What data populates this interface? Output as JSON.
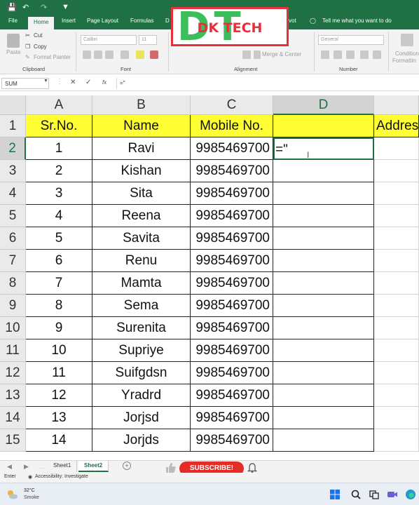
{
  "ribbon_tabs": [
    "File",
    "Home",
    "Insert",
    "Page Layout",
    "Formulas",
    "D",
    "vot"
  ],
  "tell_me": "Tell me what you want to do",
  "clipboard": {
    "cut": "Cut",
    "copy": "Copy",
    "paste": "Paste",
    "format_painter": "Format Painter",
    "group": "Clipboard"
  },
  "font": {
    "name": "Calibri",
    "size": "11",
    "group": "Font"
  },
  "alignment": {
    "merge": "Merge & Center",
    "group": "Alignment"
  },
  "number": {
    "format": "General",
    "group": "Number"
  },
  "styles": {
    "conditional": "Condition",
    "formatting": "Formattin"
  },
  "logo": {
    "letters": "DT",
    "brand": "DK TECH"
  },
  "formula_bar": {
    "name_box": "SUM",
    "fx": "fx",
    "content": "=\""
  },
  "grid": {
    "columns": [
      "A",
      "B",
      "C",
      "D",
      ""
    ],
    "header_row": {
      "sr": "Sr.No.",
      "name": "Name",
      "mobile": "Mobile No.",
      "d": "",
      "address": "Addres"
    },
    "rows": [
      {
        "row": "2",
        "sr": "1",
        "name": "Ravi",
        "mobile": "9985469700",
        "d": "=\""
      },
      {
        "row": "3",
        "sr": "2",
        "name": "Kishan",
        "mobile": "9985469700",
        "d": ""
      },
      {
        "row": "4",
        "sr": "3",
        "name": "Sita",
        "mobile": "9985469700",
        "d": ""
      },
      {
        "row": "5",
        "sr": "4",
        "name": "Reena",
        "mobile": "9985469700",
        "d": ""
      },
      {
        "row": "6",
        "sr": "5",
        "name": "Savita",
        "mobile": "9985469700",
        "d": ""
      },
      {
        "row": "7",
        "sr": "6",
        "name": "Renu",
        "mobile": "9985469700",
        "d": ""
      },
      {
        "row": "8",
        "sr": "7",
        "name": "Mamta",
        "mobile": "9985469700",
        "d": ""
      },
      {
        "row": "9",
        "sr": "8",
        "name": "Sema",
        "mobile": "9985469700",
        "d": ""
      },
      {
        "row": "10",
        "sr": "9",
        "name": "Surenita",
        "mobile": "9985469700",
        "d": ""
      },
      {
        "row": "11",
        "sr": "10",
        "name": "Supriye",
        "mobile": "9985469700",
        "d": ""
      },
      {
        "row": "12",
        "sr": "11",
        "name": "Suifgdsn",
        "mobile": "9985469700",
        "d": ""
      },
      {
        "row": "13",
        "sr": "12",
        "name": "Yradrd",
        "mobile": "9985469700",
        "d": ""
      },
      {
        "row": "14",
        "sr": "13",
        "name": "Jorjsd",
        "mobile": "9985469700",
        "d": ""
      },
      {
        "row": "15",
        "sr": "14",
        "name": "Jorjds",
        "mobile": "9985469700",
        "d": ""
      }
    ]
  },
  "sheets": [
    "Sheet1",
    "Sheet2"
  ],
  "active_sheet": "Sheet2",
  "subscribe": "SUBSCRIBE!",
  "status": {
    "mode": "Enter",
    "accessibility": "Accessibility: Investigate"
  },
  "taskbar": {
    "temp": "32°C",
    "weather": "Smoke"
  },
  "colors": {
    "excel_green": "#1f7145",
    "header_yellow": "#ffff33",
    "subscribe_red": "#e52d27"
  }
}
